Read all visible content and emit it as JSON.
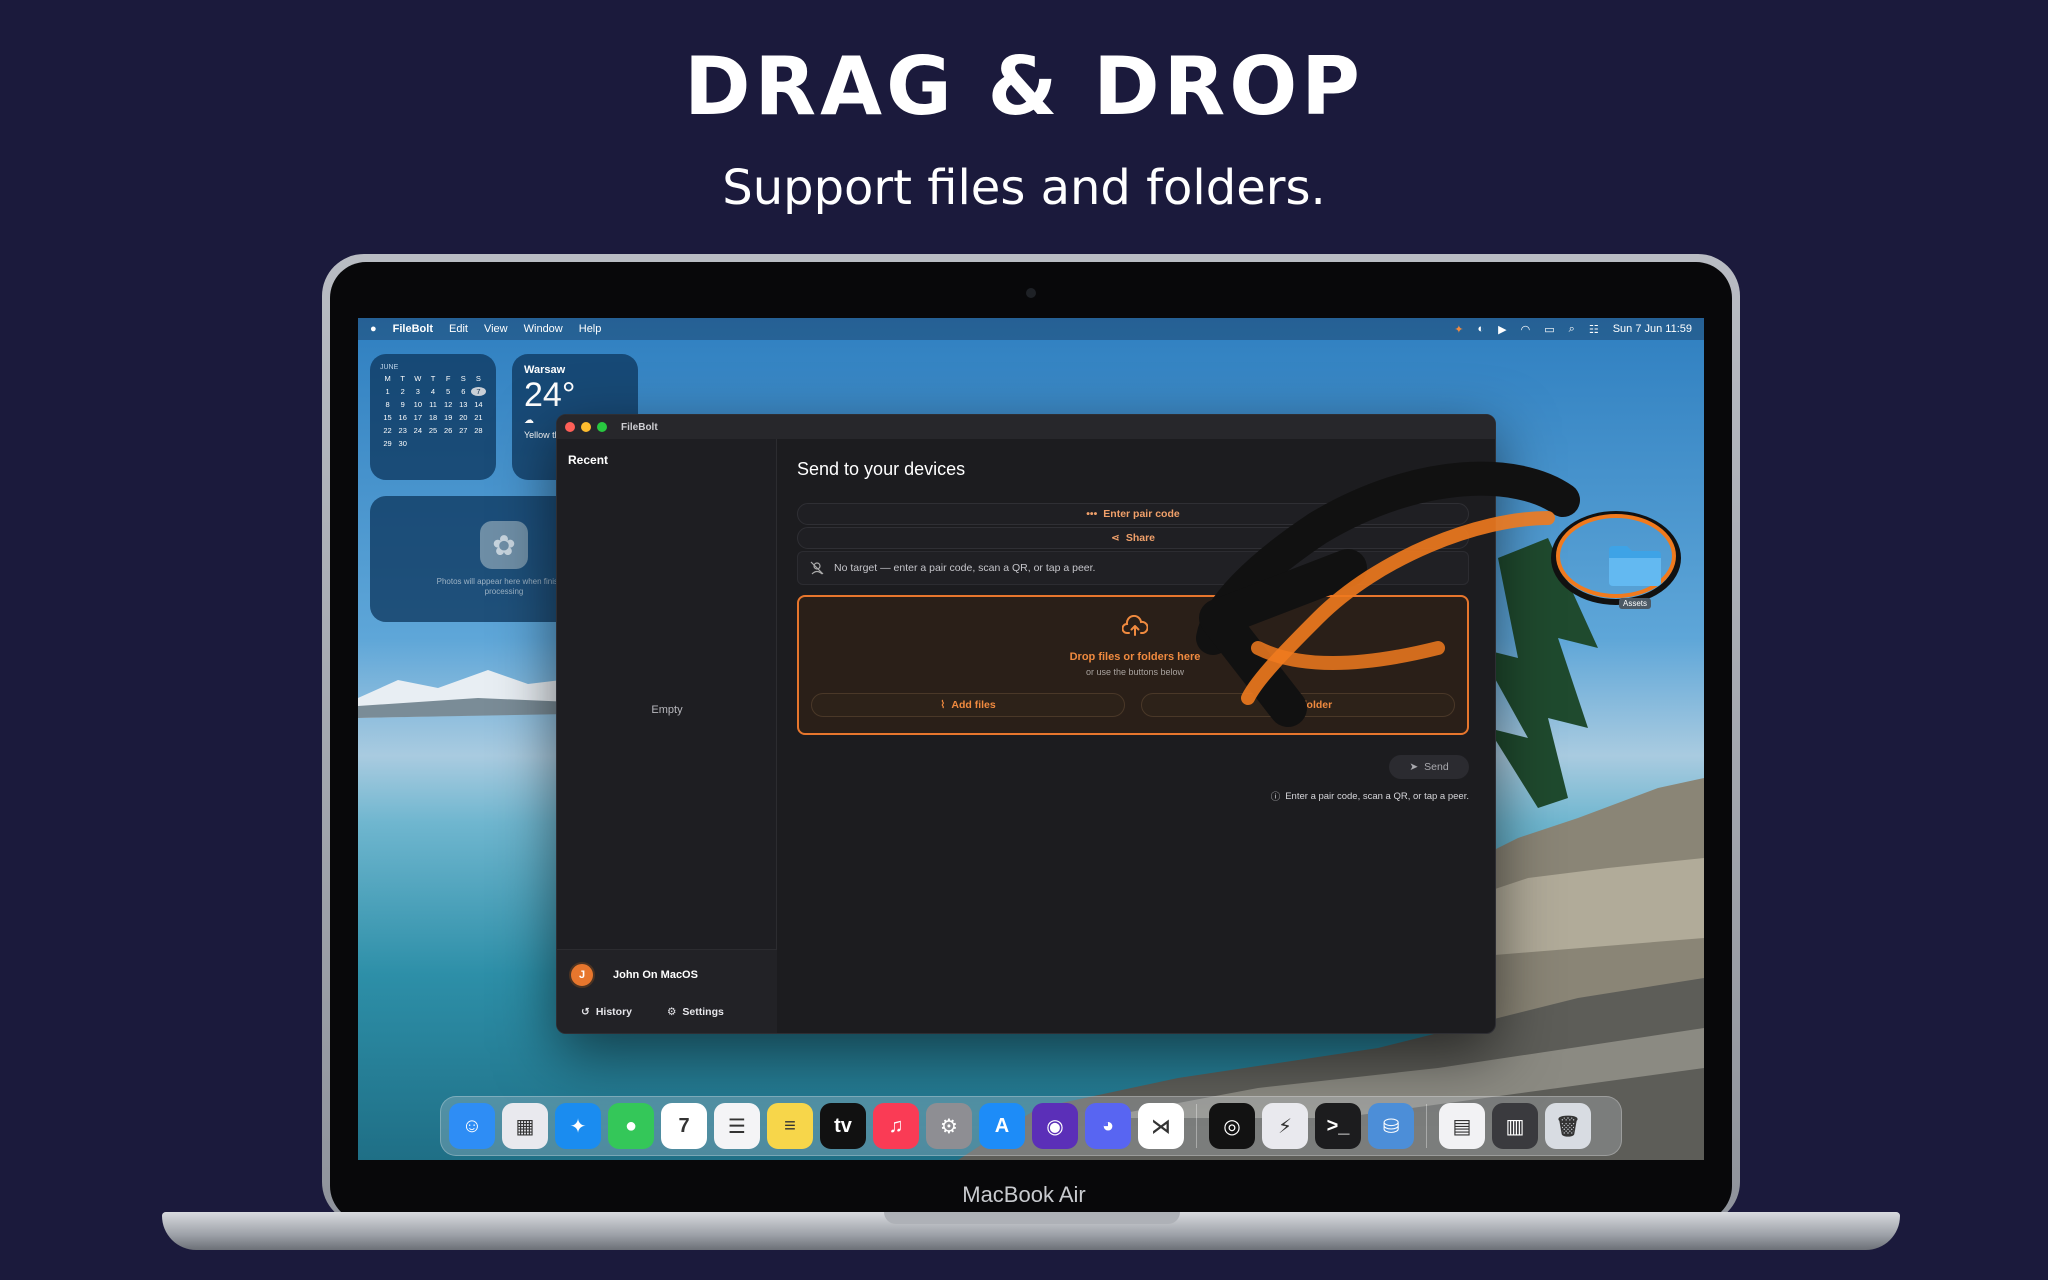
{
  "promo": {
    "title": "DRAG & DROP",
    "subtitle": "Support files and folders."
  },
  "device": {
    "model_label": "MacBook Air"
  },
  "menubar": {
    "app_name": "FileBolt",
    "menus": [
      "Edit",
      "View",
      "Window",
      "Help"
    ],
    "datetime": "Sun 7 Jun  11:59",
    "status_icons": [
      "ai-icon",
      "focus-icon",
      "play-icon",
      "wifi-icon",
      "battery-icon",
      "spotlight-icon",
      "control-center-icon"
    ]
  },
  "widgets": {
    "calendar": {
      "month": "JUNE",
      "weekdays": [
        "M",
        "T",
        "W",
        "T",
        "F",
        "S",
        "S"
      ],
      "days": [
        "1",
        "2",
        "3",
        "4",
        "5",
        "6",
        "7",
        "8",
        "9",
        "10",
        "11",
        "12",
        "13",
        "14",
        "15",
        "16",
        "17",
        "18",
        "19",
        "20",
        "21",
        "22",
        "23",
        "24",
        "25",
        "26",
        "27",
        "28",
        "29",
        "30"
      ],
      "today": "7"
    },
    "weather": {
      "city": "Warsaw",
      "temperature": "24°",
      "condition": "Yellow thund"
    },
    "photos": {
      "message": "Photos will appear here when finished processing",
      "icon": "photos-flower-icon"
    }
  },
  "window": {
    "title": "FileBolt",
    "sidebar": {
      "heading": "Recent",
      "empty_text": "Empty",
      "user": {
        "initial": "J",
        "name": "John On MacOS"
      },
      "history_label": "History",
      "settings_label": "Settings"
    },
    "main": {
      "heading": "Send to your devices",
      "pair_code_label": "Enter pair code",
      "share_label": "Share",
      "status_text": "No target — enter a pair code, scan a QR, or tap a peer.",
      "dropzone": {
        "title": "Drop files or folders here",
        "subtitle": "or use the buttons below",
        "add_files_label": "Add files",
        "add_folder_label": "Add folder"
      },
      "send_label": "Send",
      "hint_text": "Enter a pair code, scan a QR, or tap a peer."
    }
  },
  "desktop": {
    "folder_label": "Assets"
  },
  "dock": {
    "apps": [
      {
        "name": "Finder",
        "icon": "finder-icon",
        "color": "#2e8df5",
        "glyph": "☺"
      },
      {
        "name": "Launchpad",
        "icon": "launchpad-icon",
        "color": "#e9e9ee",
        "glyph": "▦"
      },
      {
        "name": "Safari",
        "icon": "safari-icon",
        "color": "#1a8cf0",
        "glyph": "✦"
      },
      {
        "name": "Messages",
        "icon": "messages-icon",
        "color": "#34c759",
        "glyph": "●"
      },
      {
        "name": "Calendar",
        "icon": "calendar-icon",
        "color": "#ffffff",
        "glyph": "7"
      },
      {
        "name": "Reminders",
        "icon": "reminders-icon",
        "color": "#f4f4f6",
        "glyph": "☰"
      },
      {
        "name": "Notes",
        "icon": "notes-icon",
        "color": "#f7d64a",
        "glyph": "≡"
      },
      {
        "name": "TV",
        "icon": "tv-icon",
        "color": "#111111",
        "glyph": "tv"
      },
      {
        "name": "Music",
        "icon": "music-icon",
        "color": "#fa3b55",
        "glyph": "♫"
      },
      {
        "name": "System Settings",
        "icon": "settings-gear-icon",
        "color": "#8e8e93",
        "glyph": "⚙"
      },
      {
        "name": "App Store",
        "icon": "app-store-icon",
        "color": "#1d8cf8",
        "glyph": "A"
      },
      {
        "name": "Firefox",
        "icon": "firefox-icon",
        "color": "#5b2fb8",
        "glyph": "◉"
      },
      {
        "name": "Discord",
        "icon": "discord-icon",
        "color": "#5865f2",
        "glyph": "◕"
      },
      {
        "name": "VS Code",
        "icon": "vscode-icon",
        "color": "#ffffff",
        "glyph": "⋊"
      },
      {
        "name": "Spotify",
        "icon": "spotify-icon",
        "color": "#121212",
        "glyph": "◎"
      },
      {
        "name": "FileBolt",
        "icon": "filebolt-icon",
        "color": "#e9e9ee",
        "glyph": "⚡"
      },
      {
        "name": "Terminal",
        "icon": "terminal-icon",
        "color": "#1c1c1e",
        "glyph": ">_"
      },
      {
        "name": "Database",
        "icon": "database-icon",
        "color": "#4c8ed8",
        "glyph": "⛁"
      },
      {
        "name": "Preview",
        "icon": "document-icon",
        "color": "#f2f2f4",
        "glyph": "▤"
      },
      {
        "name": "Downloads",
        "icon": "downloads-stack-icon",
        "color": "#3a3a3e",
        "glyph": "▥"
      },
      {
        "name": "Trash",
        "icon": "trash-icon",
        "color": "#d8dce2",
        "glyph": "🗑"
      }
    ]
  },
  "colors": {
    "accent": "#e7762d",
    "background": "#1b1a3c",
    "window_bg": "#1c1c1f"
  }
}
